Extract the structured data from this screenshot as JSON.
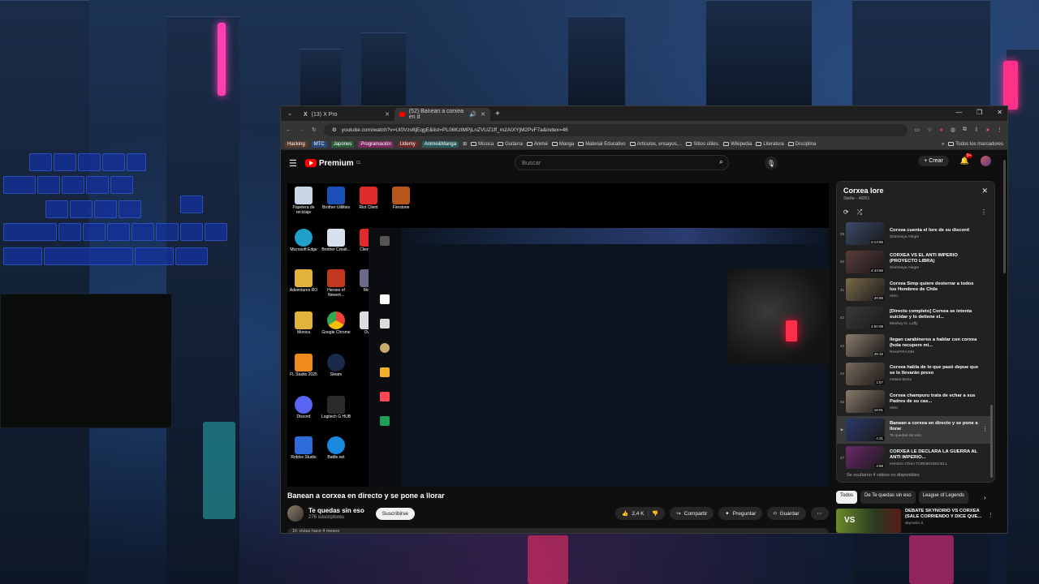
{
  "browser": {
    "tabs": [
      {
        "title": "(13) X Pro",
        "active": false
      },
      {
        "title": "(52) Banean a corxea en d",
        "active": true
      }
    ],
    "url": "youtube.com/watch?v=Ui0Vzv8jEqgE&list=PL06KztMPjLnZVUZ1ff_m2AIXYjM2PvF7a&index=46",
    "bookmarks": {
      "chips": [
        {
          "label": "Hacking",
          "color": "#5a3a2a"
        },
        {
          "label": "MTC",
          "color": "#2b4a7a"
        },
        {
          "label": "Japones",
          "color": "#2a5a3a"
        },
        {
          "label": "Programación",
          "color": "#7a2a5a"
        },
        {
          "label": "Udemy",
          "color": "#6a2a2a"
        },
        {
          "label": "Anime&Manga",
          "color": "#2a5a5a"
        }
      ],
      "folders": [
        "Música",
        "Guitarra",
        "Animé",
        "Manga",
        "Material Educativo",
        "Artículos, ensayos,...",
        "Sitios útiles.",
        "Wikipedia",
        "Literatura",
        "Disciplina"
      ],
      "overflow": "»",
      "all": "Todos los marcadores"
    }
  },
  "youtube": {
    "logo": "Premium",
    "logo_region": "CL",
    "search_placeholder": "Buscar",
    "create_label": "Crear",
    "notif_count": "9+",
    "video": {
      "title": "Banean a corxea en directo y se pone a llorar",
      "channel": "Te quedas sin eso",
      "subscribers": "276 suscriptores",
      "subscribe_label": "Suscribirse",
      "likes": "2,4 K",
      "share": "Compartir",
      "ask": "Preguntar",
      "save": "Guardar",
      "desc_peek": "1K vistas  hace 4 meses"
    },
    "desktop_icons": [
      "Papelera de reciclaje",
      "Brother Utilities",
      "Riot Client",
      "Firestone",
      "Microsoft Edge",
      "Brother Creati...",
      "Client Ric",
      "Adventures RO",
      "Heroes of Newert...",
      "Moba",
      "Monica",
      "Google Chrome",
      "Over",
      "FL Studio 2025",
      "Steam",
      "Discord",
      "Logitech G HUB",
      "Roblox Studio",
      "Battle.net"
    ],
    "playlist": {
      "title": "Corxea lore",
      "subtitle": "Stelle - 46/51",
      "items": [
        {
          "idx": "39",
          "title": "Corxea cuenta el lore de su discord",
          "channel": "Shirimoya Alegre",
          "duration": "3:13:56",
          "thumb": "#3a4a6a",
          "current": false
        },
        {
          "idx": "40",
          "title": "CORXEA VS EL ANTI IMPERIO (PROYECTO LIBRA)",
          "channel": "Shirimoya Alegre",
          "duration": "4:43:56",
          "thumb": "#5a3a3a",
          "current": false
        },
        {
          "idx": "41",
          "title": "Corxea Simp quiere desterrar a todos los Hombres de Chile",
          "channel": "retro",
          "duration": "26:55",
          "thumb": "#7a6a4a",
          "current": false
        },
        {
          "idx": "42",
          "title": "[Directo completo] Corxea se intenta suicidar y lo detiene el...",
          "channel": "Monkey D. Luffy",
          "duration": "4:00:09",
          "thumb": "#3a3a3a",
          "current": false
        },
        {
          "idx": "43",
          "title": "llegan carabineros a hablar con corxea (hola recupere mi...",
          "channel": "ResoFIFA DM",
          "duration": "29:16",
          "thumb": "#8a7a6a",
          "current": false
        },
        {
          "idx": "44",
          "title": "Corxea habla de lo que pasó depue que se lo llevarán preso",
          "channel": "matias beiza",
          "duration": "1:57",
          "thumb": "#7a6a5a",
          "current": false
        },
        {
          "idx": "45",
          "title": "Corxea champuru trata de echar a sus Padres de su cas...",
          "channel": "retro",
          "duration": "18:01",
          "thumb": "#8a7a6a",
          "current": false
        },
        {
          "idx": "▶",
          "title": "Banean a corxea en directo y se pone a llorar",
          "channel": "Te quedas sin eso",
          "duration": "4:31",
          "thumb": "#2a3a6a",
          "current": true
        },
        {
          "idx": "47",
          "title": "CORXEA LE DECLARA LA GUERRA AL ANTI IMPERIO...",
          "channel": "Hombro Chino TORNEODECELL",
          "duration": "3:58",
          "thumb": "#6a2a6a",
          "current": false
        }
      ],
      "hidden_note": "Se ocultaron 4 videos no disponibles"
    },
    "chips": [
      "Todos",
      "De Te quedas sin eso",
      "League of Legends"
    ],
    "recommended": {
      "title": "DEBATE SKYNORIO VS CORXEA (SALE CORRIENDO Y DICE QUE...",
      "channel": "skynorio 3",
      "thumb_text": "VS"
    }
  }
}
